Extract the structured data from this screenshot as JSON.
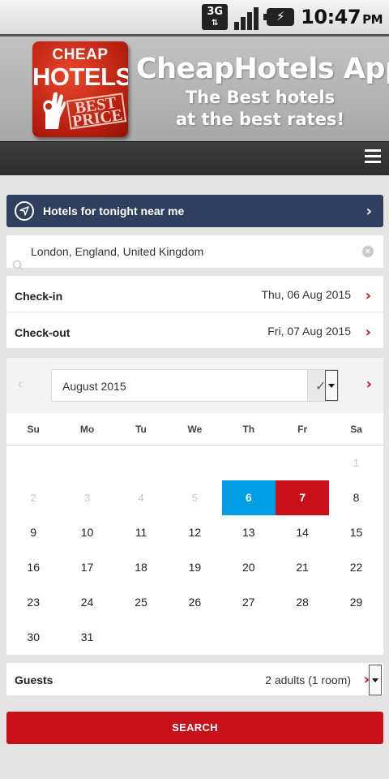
{
  "status_bar": {
    "network": "3G",
    "time": "10:47",
    "ampm": "PM",
    "icons": [
      "network-3g-icon",
      "signal-icon",
      "battery-charging-icon"
    ]
  },
  "banner": {
    "logo_line1": "CHEAP",
    "logo_line2": "HOTELS",
    "logo_line3": "BEST PRICE",
    "title": "CheapHotels App",
    "subtitle_line1": "The Best hotels",
    "subtitle_line2": "at the best rates!"
  },
  "nearby": {
    "label": "Hotels for tonight near me"
  },
  "search": {
    "value": "London, England, United Kingdom"
  },
  "dates": {
    "checkin_label": "Check-in",
    "checkin_value": "Thu, 06 Aug 2015",
    "checkout_label": "Check-out",
    "checkout_value": "Fri, 07 Aug 2015"
  },
  "calendar": {
    "month": "August 2015",
    "weekdays": [
      "Su",
      "Mo",
      "Tu",
      "We",
      "Th",
      "Fr",
      "Sa"
    ],
    "weeks": [
      [
        "",
        "",
        "",
        "",
        "",
        "",
        "1"
      ],
      [
        "2",
        "3",
        "4",
        "5",
        "6",
        "7",
        "8"
      ],
      [
        "9",
        "10",
        "11",
        "12",
        "13",
        "14",
        "15"
      ],
      [
        "16",
        "17",
        "18",
        "19",
        "20",
        "21",
        "22"
      ],
      [
        "23",
        "24",
        "25",
        "26",
        "27",
        "28",
        "29"
      ],
      [
        "30",
        "31",
        "",
        "",
        "",
        "",
        ""
      ]
    ],
    "muted_days": [
      "1",
      "2",
      "3",
      "4",
      "5"
    ],
    "checkin_day": "6",
    "checkout_day": "7",
    "colors": {
      "checkin": "#009ee3",
      "checkout": "#c8101a"
    }
  },
  "guests": {
    "label": "Guests",
    "value": "2 adults (1 room)"
  },
  "search_button": {
    "label": "SEARCH"
  },
  "colors": {
    "accent": "#c8101a",
    "nav_bar": "#2f3f5f",
    "header": "#333333"
  }
}
